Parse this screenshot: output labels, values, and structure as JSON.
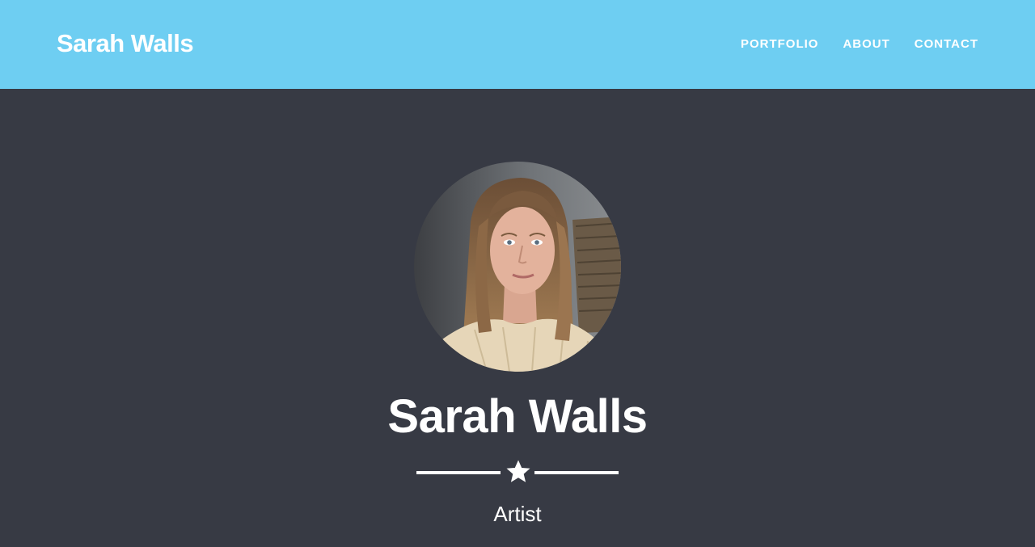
{
  "navbar": {
    "brand": "Sarah Walls",
    "items": [
      {
        "label": "PORTFOLIO"
      },
      {
        "label": "ABOUT"
      },
      {
        "label": "CONTACT"
      }
    ]
  },
  "hero": {
    "title": "Sarah Walls",
    "subtitle": "Artist",
    "divider_icon": "star-icon"
  },
  "colors": {
    "navbar_bg": "#6ecef2",
    "hero_bg": "#373a44",
    "text": "#ffffff"
  }
}
